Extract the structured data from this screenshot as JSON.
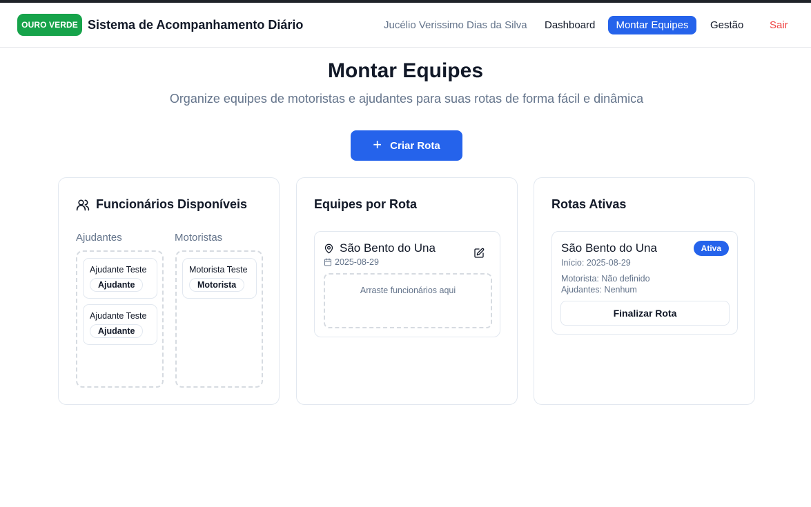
{
  "header": {
    "logo": "OURO VERDE",
    "title": "Sistema de Acompanhamento Diário",
    "user": "Jucélio Verissimo Dias da Silva",
    "nav": {
      "dashboard": "Dashboard",
      "teams": "Montar Equipes",
      "management": "Gestão",
      "logout": "Sair"
    }
  },
  "page": {
    "title": "Montar Equipes",
    "subtitle": "Organize equipes de motoristas e ajudantes para suas rotas de forma fácil e dinâmica",
    "create_button": "Criar Rota"
  },
  "available": {
    "title": "Funcionários Disponíveis",
    "helpers_label": "Ajudantes",
    "drivers_label": "Motoristas",
    "helpers": [
      {
        "name": "Ajudante Teste",
        "role": "Ajudante"
      },
      {
        "name": "Ajudante Teste",
        "role": "Ajudante"
      }
    ],
    "drivers": [
      {
        "name": "Motorista Teste",
        "role": "Motorista"
      }
    ]
  },
  "teams": {
    "title": "Equipes por Rota",
    "route": {
      "name": "São Bento do Una",
      "date": "2025-08-29",
      "drop_hint": "Arraste funcionários aqui"
    }
  },
  "active": {
    "title": "Rotas Ativas",
    "route": {
      "name": "São Bento do Una",
      "badge": "Ativa",
      "start": "Início: 2025-08-29",
      "driver": "Motorista: Não definido",
      "helpers": "Ajudantes: Nenhum",
      "finish_button": "Finalizar Rota"
    }
  },
  "colors": {
    "brand_green": "#16a34a",
    "primary_blue": "#2563eb",
    "danger_red": "#ef4444"
  }
}
